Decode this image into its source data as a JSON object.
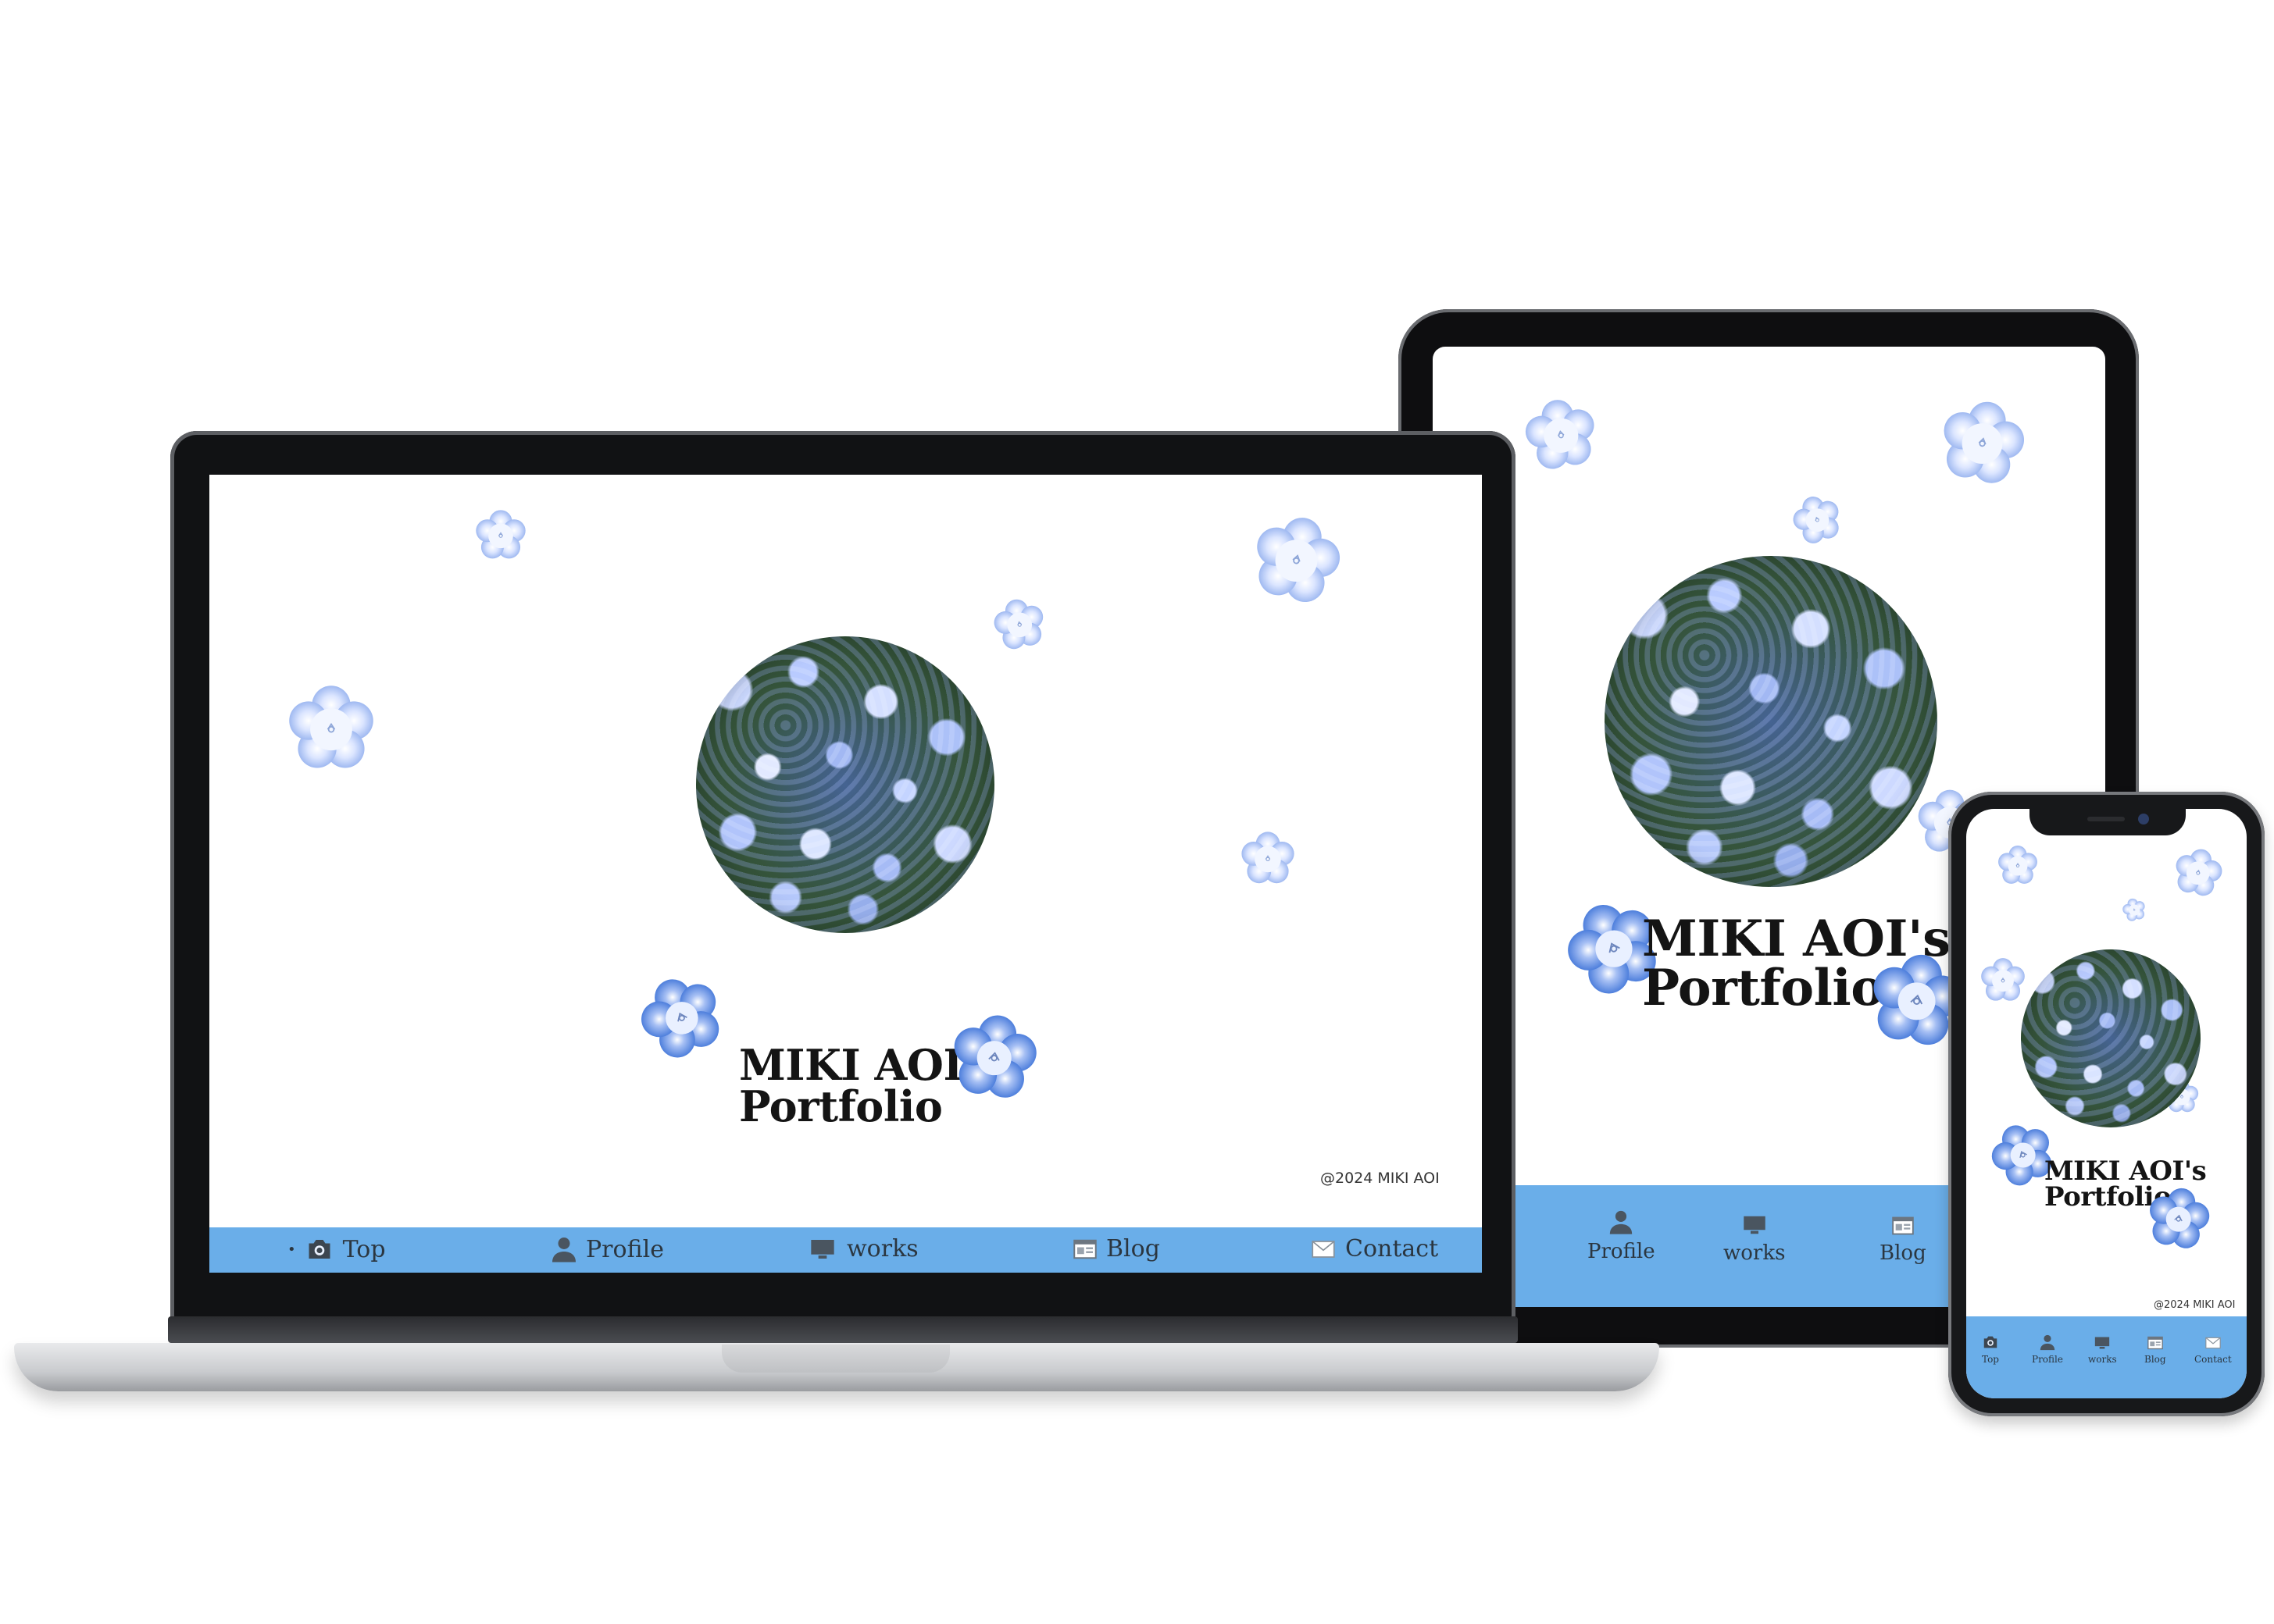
{
  "site": {
    "title_line1": "MIKI AOI's",
    "title_line2": "Portfolio",
    "copyright": "@2024 MIKI AOI"
  },
  "nav": {
    "top": "Top",
    "profile": "Profile",
    "works": "works",
    "blog": "Blog",
    "contact": "Contact"
  },
  "colors": {
    "nav_bar": "#6aaee9",
    "flower_light": "#e7eeff",
    "flower_mid": "#93b3ef",
    "flower_deep": "#4c7fde"
  },
  "icons": [
    "camera-icon",
    "person-icon",
    "monitor-icon",
    "browser-icon",
    "mail-icon",
    "flower-icon"
  ]
}
